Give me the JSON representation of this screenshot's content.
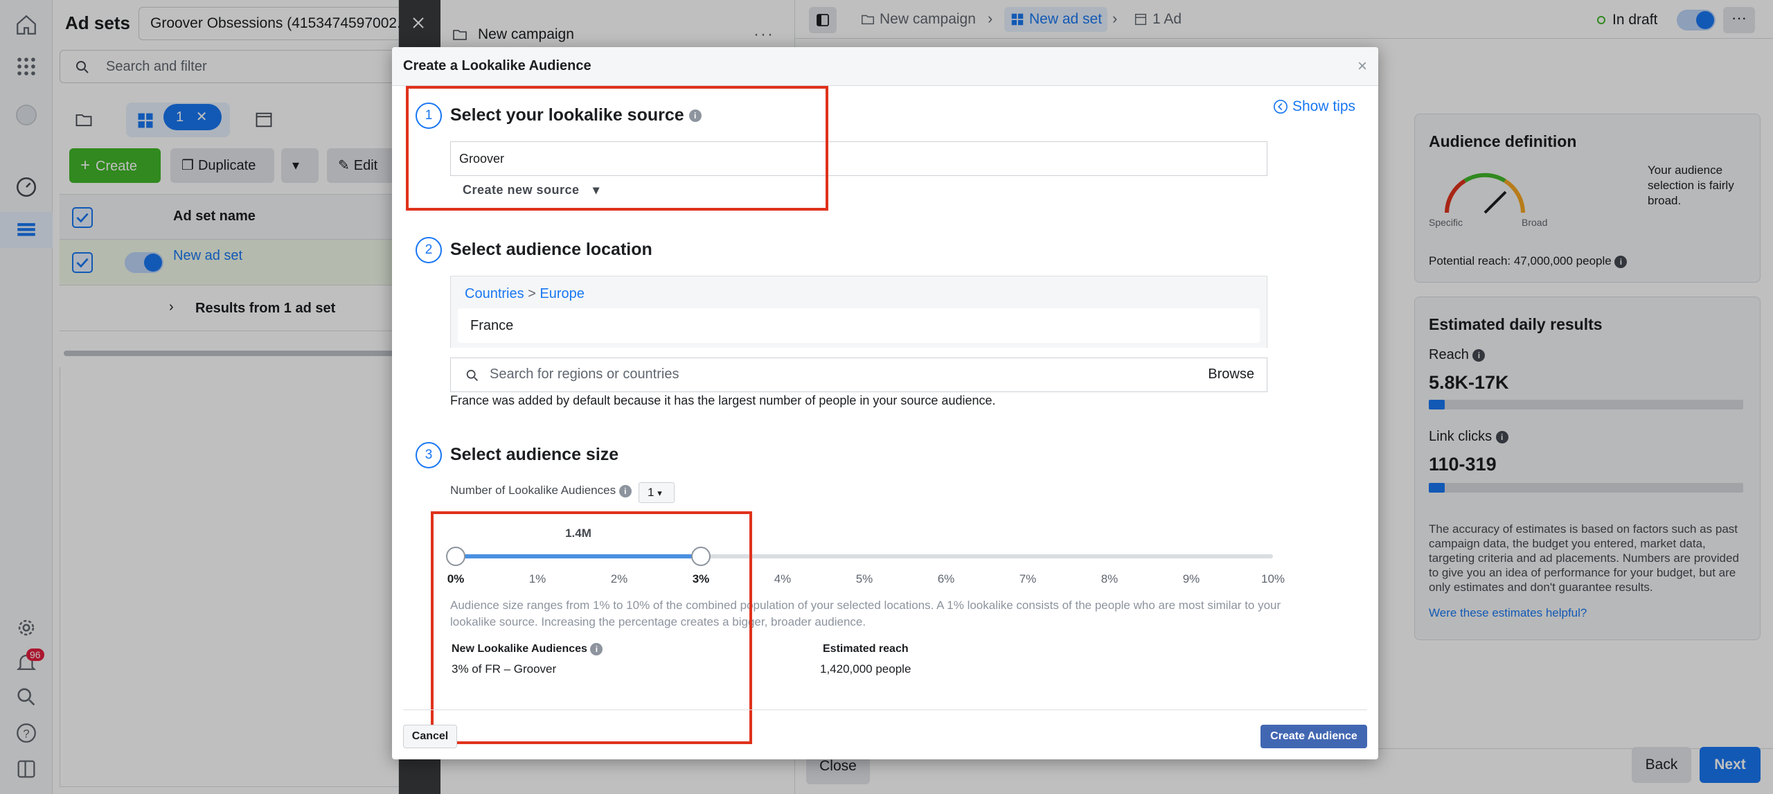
{
  "rail": {
    "notification_count": "96"
  },
  "adsets_panel": {
    "title": "Ad sets",
    "account_select": "Groover Obsessions (4153474597002...",
    "search_placeholder": "Search and filter",
    "selected_count": "1",
    "create_label": "Create",
    "duplicate_label": "Duplicate",
    "edit_label": "Edit",
    "col_ad_set_name": "Ad set name",
    "row_name": "New ad set",
    "results_label": "Results from 1 ad set"
  },
  "campaign": {
    "name": "New campaign"
  },
  "topbar": {
    "crumb_campaign": "New campaign",
    "crumb_adset": "New ad set",
    "crumb_ad": "1 Ad",
    "status": "In draft"
  },
  "audience_definition": {
    "title": "Audience definition",
    "gauge_specific": "Specific",
    "gauge_broad": "Broad",
    "description": "Your audience selection is fairly broad.",
    "potential_reach": "Potential reach: 47,000,000 people"
  },
  "estimated_daily": {
    "title": "Estimated daily results",
    "reach_label": "Reach",
    "reach_value": "5.8K-17K",
    "reach_fill": 0.05,
    "clicks_label": "Link clicks",
    "clicks_value": "110-319",
    "clicks_fill": 0.05,
    "disclaimer": "The accuracy of estimates is based on factors such as past campaign data, the budget you entered, market data, targeting criteria and ad placements. Numbers are provided to give you an idea of performance for your budget, but are only estimates and don't guarantee results.",
    "helpful_link": "Were these estimates helpful?"
  },
  "footer": {
    "close_label": "Close",
    "back_label": "Back",
    "next_label": "Next"
  },
  "modal": {
    "title": "Create a Lookalike Audience",
    "show_tips": "Show tips",
    "step1": {
      "num": "1",
      "title": "Select your lookalike source",
      "source_value": "Groover",
      "create_new_source": "Create new source"
    },
    "step2": {
      "num": "2",
      "title": "Select audience location",
      "crumb_countries": "Countries",
      "crumb_sep": ">",
      "crumb_europe": "Europe",
      "selected_location": "France",
      "search_placeholder": "Search for regions or countries",
      "browse_label": "Browse",
      "note": "France was added by default because it has the largest number of people in your source audience."
    },
    "step3": {
      "num": "3",
      "title": "Select audience size",
      "num_lookalikes_label": "Number of Lookalike Audiences",
      "num_lookalikes_value": "1",
      "slider_bubble": "1.4M",
      "slider_value_percent": 3,
      "ticks": [
        "0%",
        "1%",
        "2%",
        "3%",
        "4%",
        "5%",
        "6%",
        "7%",
        "8%",
        "9%",
        "10%"
      ],
      "description": "Audience size ranges from 1% to 10% of the combined population of your selected locations. A 1% lookalike consists of the people who are most similar to your lookalike source. Increasing the percentage creates a bigger, broader audience.",
      "new_lookalikes_label": "New Lookalike Audiences",
      "new_lookalikes_value": "3% of FR – Groover",
      "estimated_reach_label": "Estimated reach",
      "estimated_reach_value": "1,420,000 people"
    },
    "cancel_label": "Cancel",
    "create_label": "Create Audience"
  }
}
